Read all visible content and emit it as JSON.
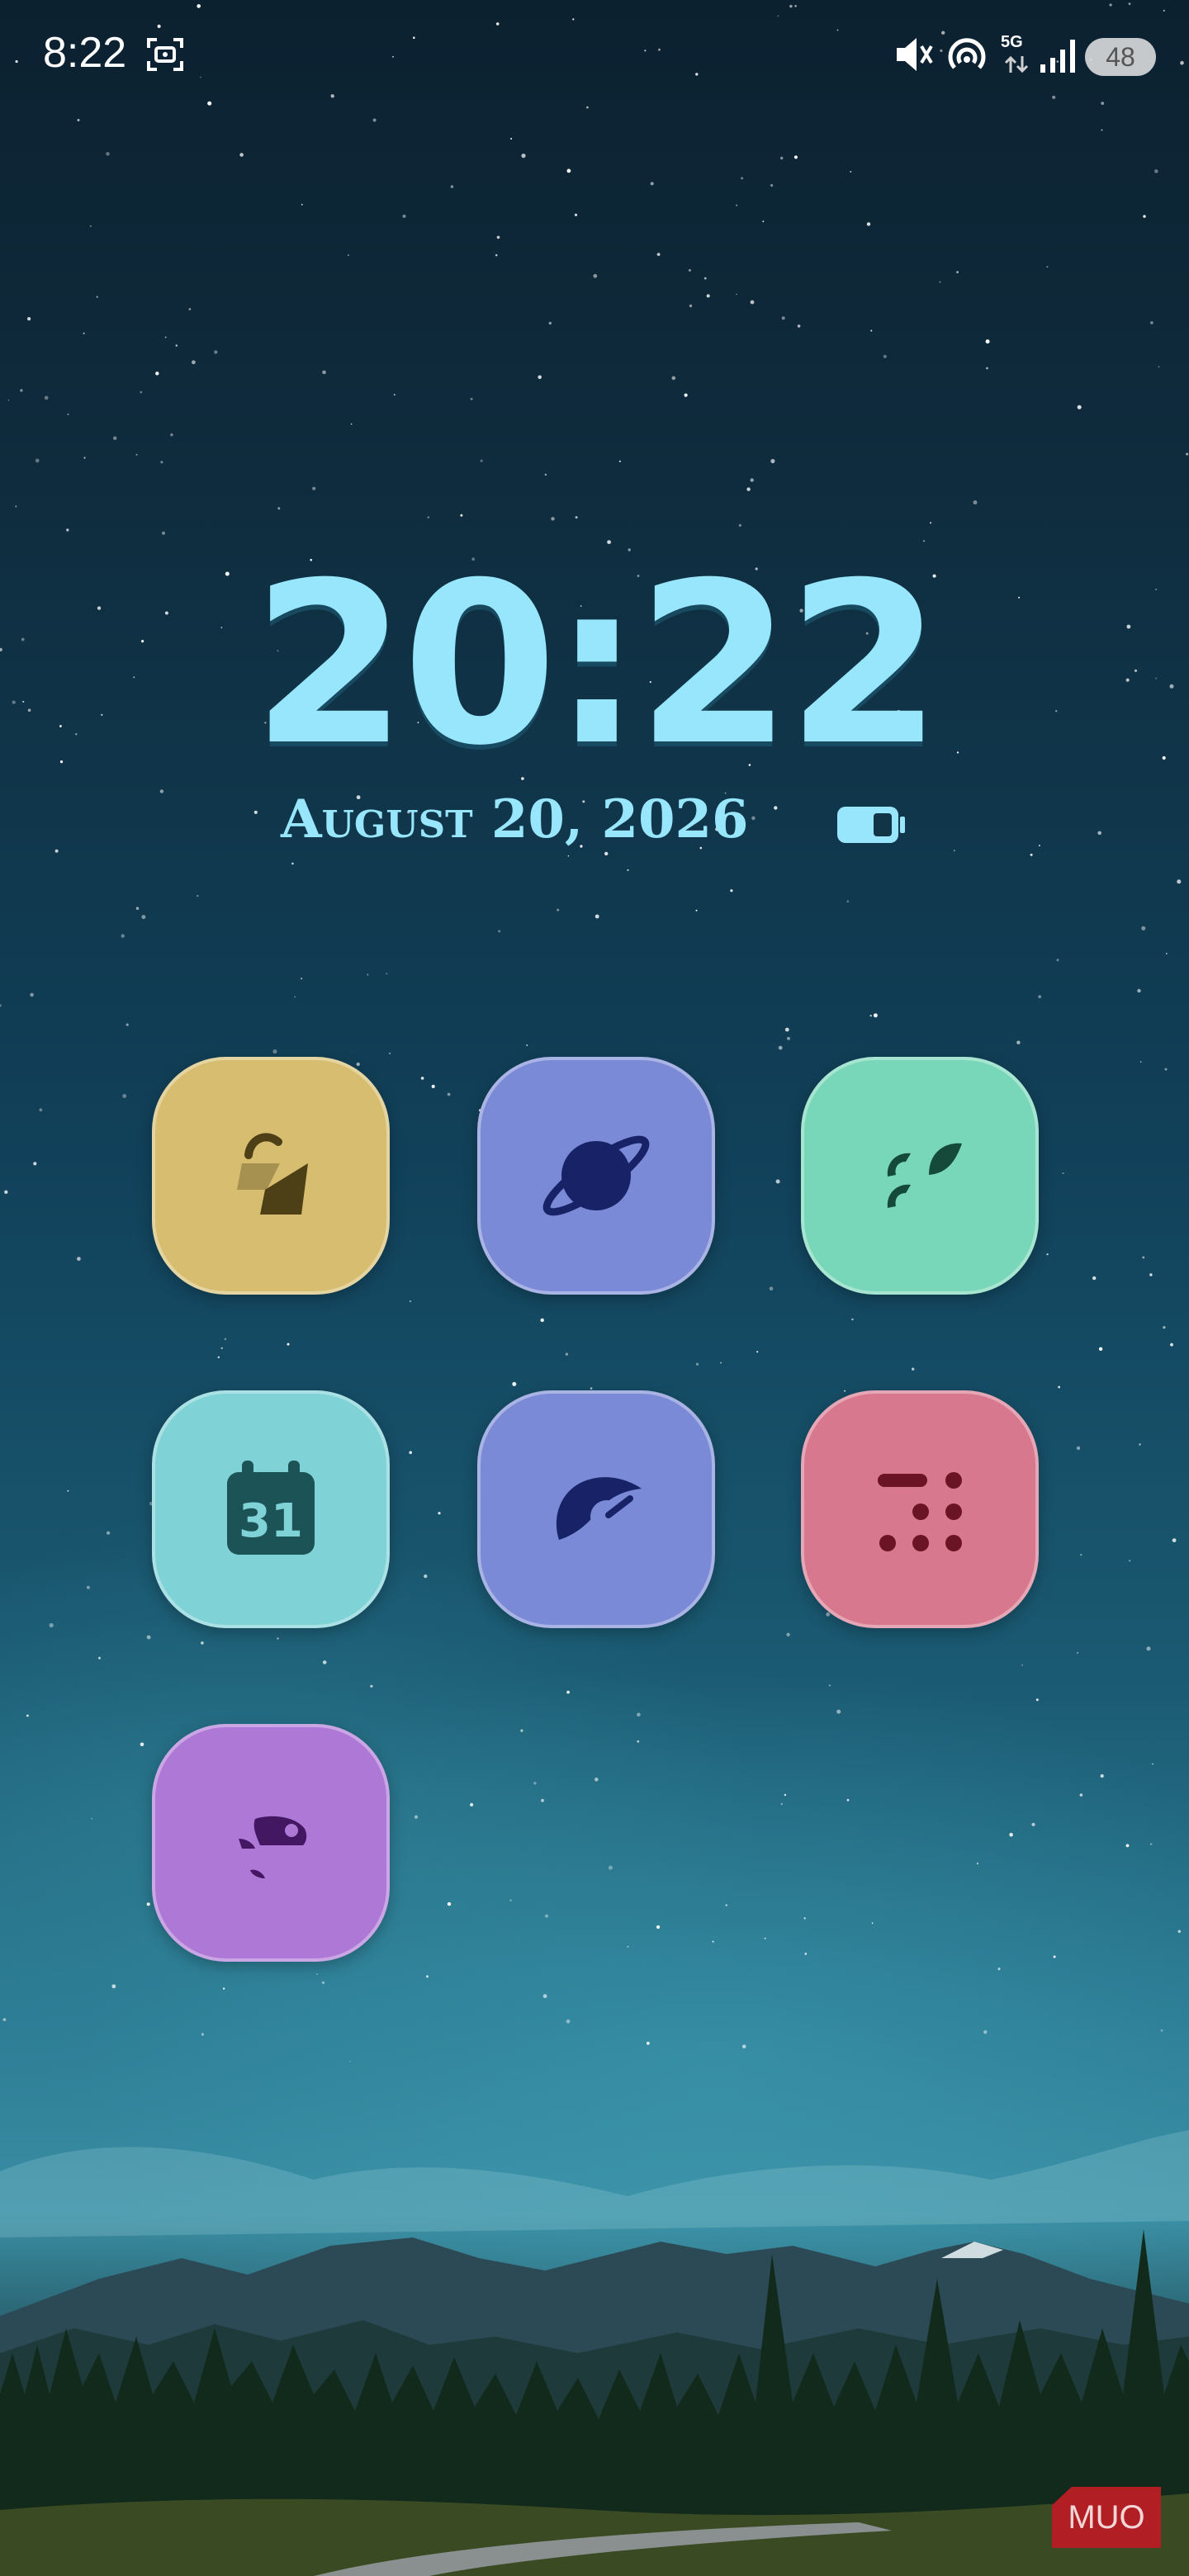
{
  "status_bar": {
    "time": "8:22",
    "network": "5G",
    "battery": "48",
    "icons": [
      "screenshot-icon",
      "mute-icon",
      "hotspot-icon",
      "network-5g-icon",
      "signal-icon",
      "battery-icon"
    ]
  },
  "lockscreen": {
    "clock": "20:22",
    "date": "August 20, 2026",
    "accent_color": "#98e6fb"
  },
  "apps": [
    {
      "name": "",
      "icon": "shopping-bag-icon",
      "color": "#d6bd6f"
    },
    {
      "name": "",
      "icon": "planet-icon",
      "color": "#7b8ad6"
    },
    {
      "name": "",
      "icon": "leaf-icon",
      "color": "#79d7b9"
    },
    {
      "name": "",
      "icon": "calendar-icon",
      "color": "#7fd2d6",
      "badge": "31"
    },
    {
      "name": "",
      "icon": "speedometer-icon",
      "color": "#7b8ad6"
    },
    {
      "name": "",
      "icon": "dialpad-icon",
      "color": "#d8788f"
    },
    {
      "name": "",
      "icon": "bird-icon",
      "color": "#ae78d6"
    }
  ],
  "watermark": "MUO"
}
